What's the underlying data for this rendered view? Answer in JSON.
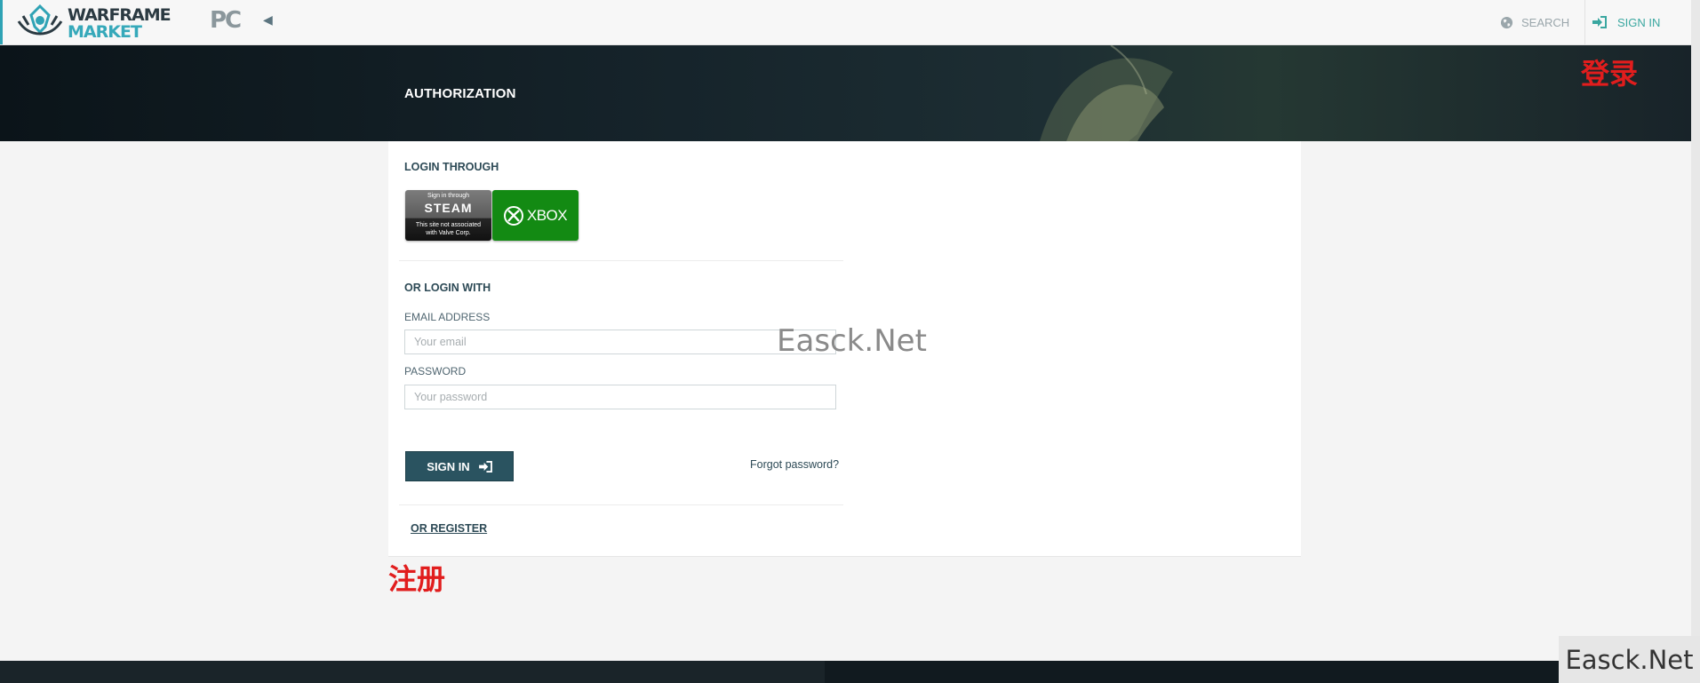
{
  "brand": {
    "name_line1": "WARFRAME",
    "name_line2": "MARKET",
    "platform": "PC"
  },
  "nav": {
    "search_label": "SEARCH",
    "signin_label": "SIGN IN"
  },
  "banner": {
    "title": "AUTHORIZATION"
  },
  "login": {
    "through_label": "LOGIN THROUGH",
    "steam": {
      "small": "Sign in through",
      "big": "STEAM",
      "note_line1": "This site not associated",
      "note_line2": "with Valve Corp."
    },
    "xbox": {
      "label": "XBOX"
    },
    "with_label": "OR LOGIN WITH",
    "email": {
      "label": "EMAIL ADDRESS",
      "placeholder": "Your email",
      "value": ""
    },
    "password": {
      "label": "PASSWORD",
      "placeholder": "Your password",
      "value": ""
    },
    "submit_label": "SIGN IN",
    "forgot_label": "Forgot password?",
    "register_label": "OR REGISTER"
  },
  "annotations": {
    "login_cn": "登录",
    "register_cn": "注册"
  },
  "watermark": {
    "center": "Easck.Net",
    "corner": "Easck.Net"
  },
  "colors": {
    "accent": "#2fa3b5",
    "primary_button": "#2a5360",
    "signin_link": "#3aa7a0",
    "annotation": "#e11d1d",
    "xbox_green": "#138a13"
  },
  "icons": {
    "nav_search": "globe-icon",
    "nav_signin": "sign-in-icon",
    "collapse": "caret-left-icon",
    "xbox": "xbox-logo-icon",
    "submit": "sign-in-icon"
  }
}
